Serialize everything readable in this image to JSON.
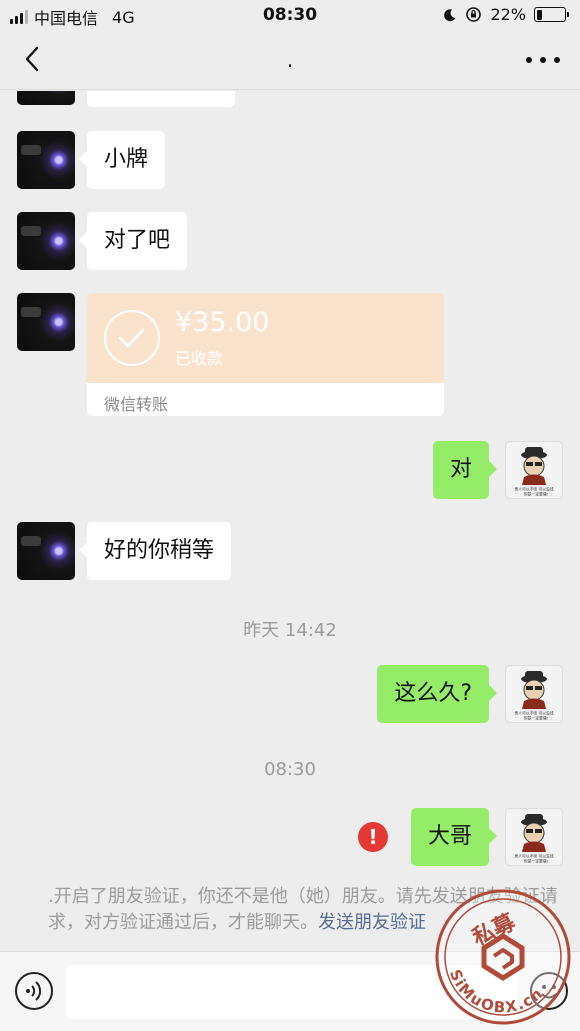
{
  "status_bar": {
    "carrier": "中国电信",
    "network": "4G",
    "time": "08:30",
    "battery_text": "22%",
    "battery_level": 0.22,
    "signal_bars": 3,
    "signal_total": 4
  },
  "nav": {
    "title": ".",
    "back_icon": "chevron-left-icon",
    "more_icon": "more-dots-icon"
  },
  "messages": {
    "m1": {
      "sender": "them",
      "text": "小牌"
    },
    "m2": {
      "sender": "them",
      "text": "对了吧"
    },
    "transfer": {
      "amount": "¥35.00",
      "status": "已收款",
      "label": "微信转账"
    },
    "m3": {
      "sender": "me",
      "text": "对"
    },
    "m4": {
      "sender": "them",
      "text": "好的你稍等"
    },
    "ts1": "昨天 14:42",
    "m5": {
      "sender": "me",
      "text": "这么久?"
    },
    "ts2": "08:30",
    "m6": {
      "sender": "me",
      "text": "大哥",
      "failed": true
    }
  },
  "system_notice": {
    "text": ".开启了朋友验证，你还不是他（她）朋友。请先发送朋友验证请求，对方验证通过后，才能聊天。",
    "link": "发送朋友验证"
  },
  "sticker_caption": {
    "line1": "男人可以不帅 可以没钱",
    "line2": "但是一定要骚!"
  },
  "input": {
    "value": "",
    "placeholder": ""
  },
  "watermark": {
    "text": "SiMuOBX.cn",
    "chars": "私募"
  },
  "colors": {
    "background": "#ededed",
    "bubble_me": "#95ec69",
    "bubble_them": "#ffffff",
    "transfer_bg": "#f9e3cc",
    "error": "#e53935",
    "link": "#576b95"
  }
}
